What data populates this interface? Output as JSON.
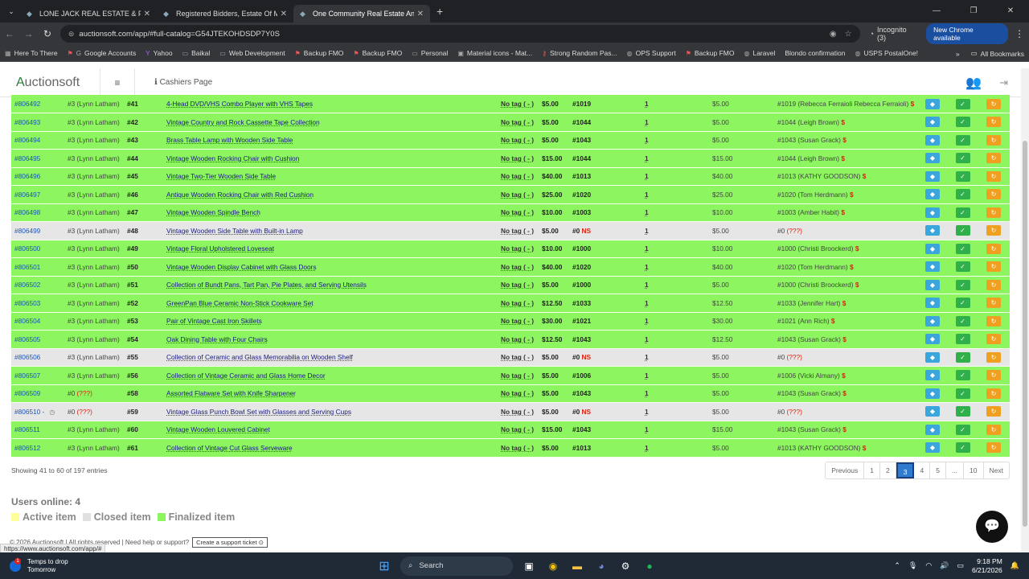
{
  "browser": {
    "tabs": [
      {
        "title": "LONE JACK REAL ESTATE & PER",
        "active": false
      },
      {
        "title": "Registered Bidders, Estate Of M",
        "active": false
      },
      {
        "title": "One Community Real Estate An",
        "active": true
      }
    ],
    "url": "auctionsoft.com/app/#full-catalog=G54JTEKOHDSDP7Y0S",
    "incognito": "Incognito (3)",
    "new_chrome": "New Chrome available",
    "bookmarks": [
      "Here To There",
      "Google Accounts",
      "Yahoo",
      "Baikal",
      "Web Development",
      "Backup FMO",
      "Backup FMO",
      "Personal",
      "Material icons - Mat...",
      "Strong Random Pas...",
      "OPS Support",
      "Backup FMO",
      "Laravel",
      "Blondo confirmation",
      "USPS PostalOne!"
    ],
    "all_bookmarks": "All Bookmarks"
  },
  "app": {
    "logo_a": "A",
    "logo_rest": "uctionsoft",
    "page": "Cashiers Page"
  },
  "rows": [
    {
      "status": "final",
      "item": "#806492",
      "seller": "#3",
      "seller_name": "(Lynn Latham)",
      "lot": "#41",
      "name": "4-Head DVD/VHS Combo Player with VHS Tapes",
      "tag": "No tag ( - )",
      "price": "$5.00",
      "bidder": "#1019",
      "ns": "",
      "qty": "1",
      "total": "$5.00",
      "buyer": "#1019",
      "buyer_name": "(Rebecca Ferraioli Rebecca Ferraioli)",
      "paid": "$"
    },
    {
      "status": "final",
      "item": "#806493",
      "seller": "#3",
      "seller_name": "(Lynn Latham)",
      "lot": "#42",
      "name": "Vintage Country and Rock Cassette Tape Collection",
      "tag": "No tag ( - )",
      "price": "$5.00",
      "bidder": "#1044",
      "ns": "",
      "qty": "1",
      "total": "$5.00",
      "buyer": "#1044",
      "buyer_name": "(Leigh Brown)",
      "paid": "$"
    },
    {
      "status": "final",
      "item": "#806494",
      "seller": "#3",
      "seller_name": "(Lynn Latham)",
      "lot": "#43",
      "name": "Brass Table Lamp with Wooden Side Table",
      "tag": "No tag ( - )",
      "price": "$5.00",
      "bidder": "#1043",
      "ns": "",
      "qty": "1",
      "total": "$5.00",
      "buyer": "#1043",
      "buyer_name": "(Susan Grack)",
      "paid": "$"
    },
    {
      "status": "final",
      "item": "#806495",
      "seller": "#3",
      "seller_name": "(Lynn Latham)",
      "lot": "#44",
      "name": "Vintage Wooden Rocking Chair with Cushion",
      "tag": "No tag ( - )",
      "price": "$15.00",
      "bidder": "#1044",
      "ns": "",
      "qty": "1",
      "total": "$15.00",
      "buyer": "#1044",
      "buyer_name": "(Leigh Brown)",
      "paid": "$"
    },
    {
      "status": "final",
      "item": "#806496",
      "seller": "#3",
      "seller_name": "(Lynn Latham)",
      "lot": "#45",
      "name": "Vintage Two-Tier Wooden Side Table",
      "tag": "No tag ( - )",
      "price": "$40.00",
      "bidder": "#1013",
      "ns": "",
      "qty": "1",
      "total": "$40.00",
      "buyer": "#1013",
      "buyer_name": "(KATHY GOODSON)",
      "paid": "$"
    },
    {
      "status": "final",
      "item": "#806497",
      "seller": "#3",
      "seller_name": "(Lynn Latham)",
      "lot": "#46",
      "name": "Antique Wooden Rocking Chair with Red Cushion",
      "tag": "No tag ( - )",
      "price": "$25.00",
      "bidder": "#1020",
      "ns": "",
      "qty": "1",
      "total": "$25.00",
      "buyer": "#1020",
      "buyer_name": "(Tom Herdmann)",
      "paid": "$"
    },
    {
      "status": "final",
      "item": "#806498",
      "seller": "#3",
      "seller_name": "(Lynn Latham)",
      "lot": "#47",
      "name": "Vintage Wooden Spindle Bench",
      "tag": "No tag ( - )",
      "price": "$10.00",
      "bidder": "#1003",
      "ns": "",
      "qty": "1",
      "total": "$10.00",
      "buyer": "#1003",
      "buyer_name": "(Amber Habit)",
      "paid": "$"
    },
    {
      "status": "closed",
      "item": "#806499",
      "seller": "#3",
      "seller_name": "(Lynn Latham)",
      "lot": "#48",
      "name": "Vintage Wooden Side Table with Built-in Lamp",
      "tag": "No tag ( - )",
      "price": "$5.00",
      "bidder": "#0",
      "ns": "NS",
      "qty": "1",
      "total": "$5.00",
      "buyer": "#0",
      "buyer_name": "(???)",
      "paid": ""
    },
    {
      "status": "final",
      "item": "#806500",
      "seller": "#3",
      "seller_name": "(Lynn Latham)",
      "lot": "#49",
      "name": "Vintage Floral Upholstered Loveseat",
      "tag": "No tag ( - )",
      "price": "$10.00",
      "bidder": "#1000",
      "ns": "",
      "qty": "1",
      "total": "$10.00",
      "buyer": "#1000",
      "buyer_name": "(Christi Broockerd)",
      "paid": "$"
    },
    {
      "status": "final",
      "item": "#806501",
      "seller": "#3",
      "seller_name": "(Lynn Latham)",
      "lot": "#50",
      "name": "Vintage Wooden Display Cabinet with Glass Doors",
      "tag": "No tag ( - )",
      "price": "$40.00",
      "bidder": "#1020",
      "ns": "",
      "qty": "1",
      "total": "$40.00",
      "buyer": "#1020",
      "buyer_name": "(Tom Herdmann)",
      "paid": "$"
    },
    {
      "status": "final",
      "item": "#806502",
      "seller": "#3",
      "seller_name": "(Lynn Latham)",
      "lot": "#51",
      "name": "Collection of Bundt Pans, Tart Pan, Pie Plates, and Serving Utensils",
      "tag": "No tag ( - )",
      "price": "$5.00",
      "bidder": "#1000",
      "ns": "",
      "qty": "1",
      "total": "$5.00",
      "buyer": "#1000",
      "buyer_name": "(Christi Broockerd)",
      "paid": "$"
    },
    {
      "status": "final",
      "item": "#806503",
      "seller": "#3",
      "seller_name": "(Lynn Latham)",
      "lot": "#52",
      "name": "GreenPan Blue Ceramic Non-Stick Cookware Set",
      "tag": "No tag ( - )",
      "price": "$12.50",
      "bidder": "#1033",
      "ns": "",
      "qty": "1",
      "total": "$12.50",
      "buyer": "#1033",
      "buyer_name": "(Jennifer Hart)",
      "paid": "$"
    },
    {
      "status": "final",
      "item": "#806504",
      "seller": "#3",
      "seller_name": "(Lynn Latham)",
      "lot": "#53",
      "name": "Pair of Vintage Cast Iron Skillets",
      "tag": "No tag ( - )",
      "price": "$30.00",
      "bidder": "#1021",
      "ns": "",
      "qty": "1",
      "total": "$30.00",
      "buyer": "#1021",
      "buyer_name": "(Ann Rich)",
      "paid": "$"
    },
    {
      "status": "final",
      "item": "#806505",
      "seller": "#3",
      "seller_name": "(Lynn Latham)",
      "lot": "#54",
      "name": "Oak Dining Table with Four Chairs",
      "tag": "No tag ( - )",
      "price": "$12.50",
      "bidder": "#1043",
      "ns": "",
      "qty": "1",
      "total": "$12.50",
      "buyer": "#1043",
      "buyer_name": "(Susan Grack)",
      "paid": "$"
    },
    {
      "status": "closed",
      "item": "#806506",
      "seller": "#3",
      "seller_name": "(Lynn Latham)",
      "lot": "#55",
      "name": "Collection of Ceramic and Glass Memorabilia on Wooden Shelf",
      "tag": "No tag ( - )",
      "price": "$5.00",
      "bidder": "#0",
      "ns": "NS",
      "qty": "1",
      "total": "$5.00",
      "buyer": "#0",
      "buyer_name": "(???)",
      "paid": ""
    },
    {
      "status": "final",
      "item": "#806507",
      "seller": "#3",
      "seller_name": "(Lynn Latham)",
      "lot": "#56",
      "name": "Collection of Vintage Ceramic and Glass Home Decor",
      "tag": "No tag ( - )",
      "price": "$5.00",
      "bidder": "#1006",
      "ns": "",
      "qty": "1",
      "total": "$5.00",
      "buyer": "#1006",
      "buyer_name": "(Vicki Almany)",
      "paid": "$"
    },
    {
      "status": "final",
      "item": "#806509",
      "seller": "#0",
      "seller_name": "(???)",
      "lot": "#58",
      "name": "Assorted Flatware Set with Knife Sharpener",
      "tag": "No tag ( - )",
      "price": "$5.00",
      "bidder": "#1043",
      "ns": "",
      "qty": "1",
      "total": "$5.00",
      "buyer": "#1043",
      "buyer_name": "(Susan Grack)",
      "paid": "$"
    },
    {
      "status": "closed",
      "item": "#806510 -",
      "seller": "#0",
      "seller_name": "(???)",
      "lot": "#59",
      "name": "Vintage Glass Punch Bowl Set with Glasses and Serving Cups",
      "tag": "No tag ( - )",
      "price": "$5.00",
      "bidder": "#0",
      "ns": "NS",
      "qty": "1",
      "total": "$5.00",
      "buyer": "#0",
      "buyer_name": "(???)",
      "paid": ""
    },
    {
      "status": "final",
      "item": "#806511",
      "seller": "#3",
      "seller_name": "(Lynn Latham)",
      "lot": "#60",
      "name": "Vintage Wooden Louvered Cabinet",
      "tag": "No tag ( - )",
      "price": "$15.00",
      "bidder": "#1043",
      "ns": "",
      "qty": "1",
      "total": "$15.00",
      "buyer": "#1043",
      "buyer_name": "(Susan Grack)",
      "paid": "$"
    },
    {
      "status": "final",
      "item": "#806512",
      "seller": "#3",
      "seller_name": "(Lynn Latham)",
      "lot": "#61",
      "name": "Collection of Vintage Cut Glass Serveware",
      "tag": "No tag ( - )",
      "price": "$5.00",
      "bidder": "#1013",
      "ns": "",
      "qty": "1",
      "total": "$5.00",
      "buyer": "#1013",
      "buyer_name": "(KATHY GOODSON)",
      "paid": "$"
    }
  ],
  "showing": "Showing 41 to 60 of 197 entries",
  "pager": {
    "previous": "Previous",
    "pages": [
      "1",
      "2",
      "3",
      "4",
      "5",
      "...",
      "10"
    ],
    "current": "3",
    "next": "Next"
  },
  "users_online": "Users online: 4",
  "legend": [
    {
      "label": "Active item",
      "color": "#ffff99"
    },
    {
      "label": "Closed item",
      "color": "#e0e0e0"
    },
    {
      "label": "Finalized item",
      "color": "#8cf55f"
    }
  ],
  "footer": {
    "text": "© 2026 Auctionsoft | All rights reserved | Need help or support?",
    "support_button": "Create a support ticket"
  },
  "status_url": "https://www.auctionsoft.com/app/#",
  "taskbar": {
    "weather_title": "Temps to drop",
    "weather_sub": "Tomorrow",
    "search": "Search",
    "time": "9:18 PM",
    "date": "6/21/2026"
  }
}
